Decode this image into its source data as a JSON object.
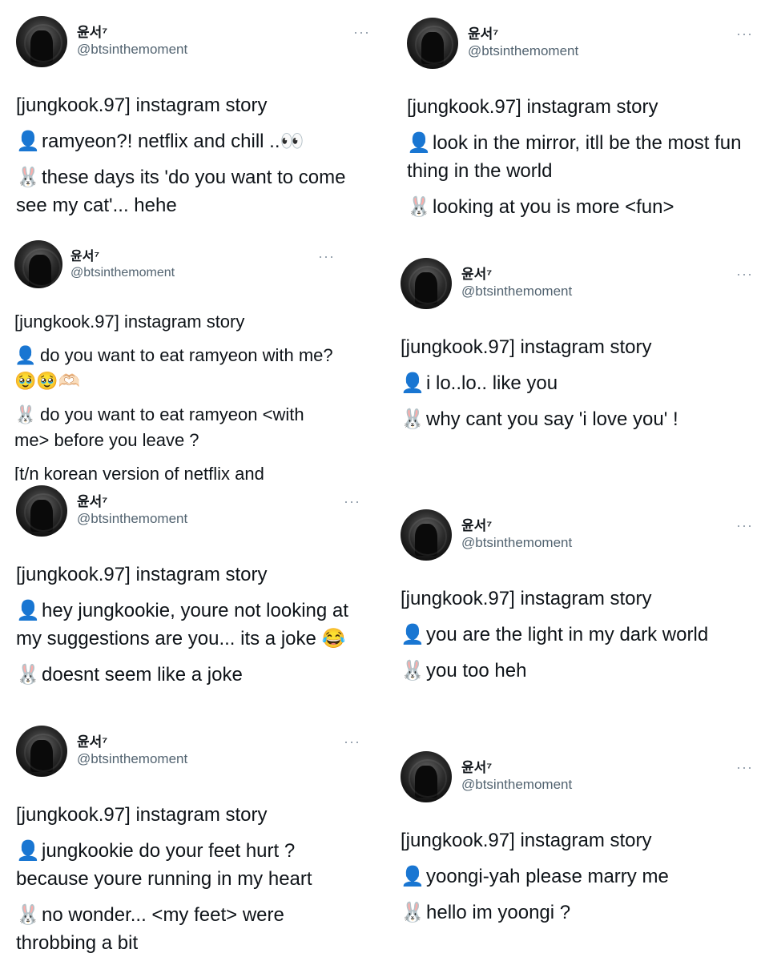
{
  "tweets": [
    {
      "name": "윤서⁷",
      "handle": "@btsinthemoment",
      "dots": "···",
      "title": "[jungkook.97] instagram story",
      "person_icon": "👤",
      "person_text": "ramyeon?! netflix and chill ..👀",
      "bunny_icon": "🐰",
      "bunny_text": "these days its 'do you want to come see my cat'... hehe",
      "extra": ""
    },
    {
      "name": "윤서⁷",
      "handle": "@btsinthemoment",
      "dots": "···",
      "title": "[jungkook.97] instagram story",
      "person_icon": "👤",
      "person_text": "look in the mirror, itll be the most fun thing in the world",
      "bunny_icon": "🐰",
      "bunny_text": "looking at you is more <fun>",
      "extra": ""
    },
    {
      "name": "윤서⁷",
      "handle": "@btsinthemoment",
      "dots": "···",
      "title": "[jungkook.97] instagram story",
      "person_icon": "👤",
      "person_text": "do you want to eat ramyeon with me? 🥹🥹🫶🏻",
      "bunny_icon": "🐰",
      "bunny_text": "do you want to eat ramyeon <with me> before you leave ?",
      "extra": "[t/n korean version of netflix and"
    },
    {
      "name": "윤서⁷",
      "handle": "@btsinthemoment",
      "dots": "···",
      "title": "[jungkook.97] instagram story",
      "person_icon": "👤",
      "person_text": "i lo..lo.. like you",
      "bunny_icon": "🐰",
      "bunny_text": "why cant you say 'i love you' !",
      "extra": ""
    },
    {
      "name": "윤서⁷",
      "handle": "@btsinthemoment",
      "dots": "···",
      "title": "[jungkook.97] instagram story",
      "person_icon": "👤",
      "person_text": "hey jungkookie, youre not looking at my suggestions are you... its a joke 😂",
      "bunny_icon": "🐰",
      "bunny_text": "doesnt seem like a joke",
      "extra": ""
    },
    {
      "name": "윤서⁷",
      "handle": "@btsinthemoment",
      "dots": "···",
      "title": "[jungkook.97] instagram story",
      "person_icon": "👤",
      "person_text": "you are the light in my dark world",
      "bunny_icon": "🐰",
      "bunny_text": "you too heh",
      "extra": ""
    },
    {
      "name": "윤서⁷",
      "handle": "@btsinthemoment",
      "dots": "···",
      "title": "[jungkook.97] instagram story",
      "person_icon": "👤",
      "person_text": "jungkookie do your feet hurt ? because youre running in my heart",
      "bunny_icon": "🐰",
      "bunny_text": "no wonder... <my feet> were throbbing a bit",
      "extra": ""
    },
    {
      "name": "윤서⁷",
      "handle": "@btsinthemoment",
      "dots": "···",
      "title": "[jungkook.97] instagram story",
      "person_icon": "👤",
      "person_text": "yoongi-yah please marry me",
      "bunny_icon": "🐰",
      "bunny_text": "hello im yoongi ?",
      "extra": ""
    }
  ]
}
